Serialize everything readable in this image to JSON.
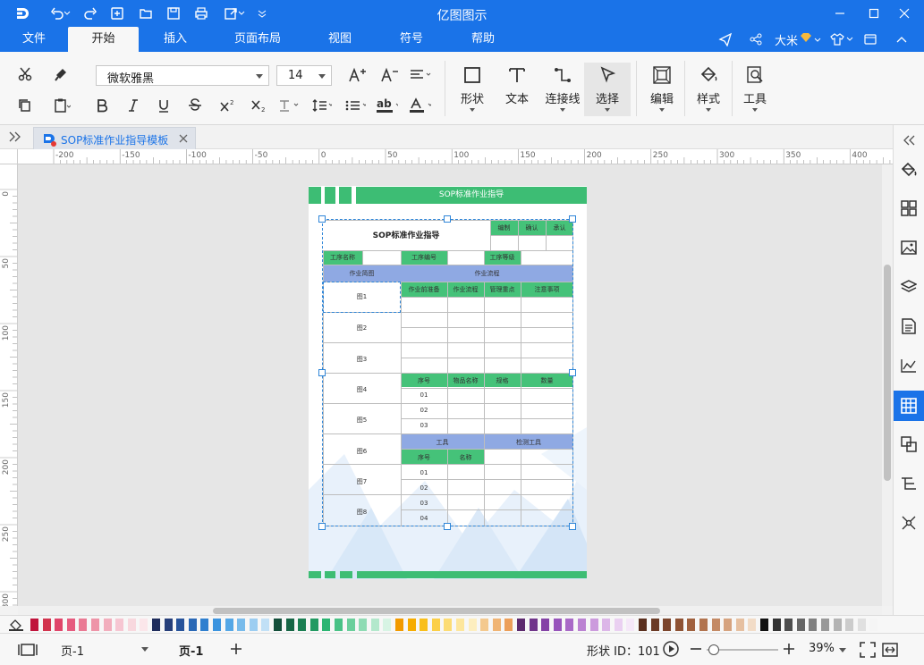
{
  "titlebar": {
    "title": "亿图图示"
  },
  "menu": {
    "tabs": [
      "文件",
      "开始",
      "插入",
      "页面布局",
      "视图",
      "符号",
      "帮助"
    ],
    "active": "开始",
    "user": "大米"
  },
  "ribbon": {
    "font_family": "微软雅黑",
    "font_size": "14",
    "big_buttons": [
      "形状",
      "文本",
      "连接线",
      "选择",
      "编辑",
      "样式",
      "工具"
    ]
  },
  "doc_tab": {
    "title": "SOP标准作业指导模板"
  },
  "ruler_h": [
    "-200",
    "-150",
    "-100",
    "-50",
    "0",
    "50",
    "100",
    "150",
    "200",
    "250",
    "300",
    "350",
    "400"
  ],
  "ruler_v": [
    "0",
    "50",
    "100",
    "150",
    "200",
    "250",
    "300"
  ],
  "sop": {
    "banner": "SOP标准作业指导",
    "title": "SOP标准作业指导",
    "approve": [
      "编制",
      "确认",
      "承认"
    ],
    "info": [
      "工序名称",
      "工序编号",
      "工序等级"
    ],
    "sections": [
      "作业简图",
      "作业流程"
    ],
    "flow_cols": [
      "作业前准备",
      "作业流程",
      "管理重点",
      "注意事项"
    ],
    "figures": [
      "图1",
      "图2",
      "图3",
      "图4",
      "图5",
      "图6",
      "图7",
      "图8"
    ],
    "material_cols": [
      "序号",
      "物品名称",
      "规格",
      "数量"
    ],
    "material_rows": [
      "01",
      "02",
      "03"
    ],
    "tool_headers": [
      "工具",
      "检测工具"
    ],
    "tool_cols": [
      "序号",
      "名称"
    ],
    "tool_rows": [
      "01",
      "02",
      "03",
      "04"
    ]
  },
  "status": {
    "page_selector": "页-1",
    "page_tab": "页-1",
    "shape_id": "形状 ID：101",
    "zoom": "39%"
  },
  "palette": [
    "#c0143c",
    "#d2344e",
    "#e0456a",
    "#e65b7f",
    "#ea7a94",
    "#ee94a8",
    "#f2aebd",
    "#f6c6d2",
    "#f8d8de",
    "#fbe6ea",
    "#1f2d5c",
    "#263f7a",
    "#27539a",
    "#2a68b6",
    "#2f7fcf",
    "#3b94df",
    "#55a7e6",
    "#78bbeb",
    "#9ccdf1",
    "#c1e0f6",
    "#134e3a",
    "#176646",
    "#1b7f53",
    "#229a62",
    "#2bb572",
    "#49c286",
    "#6bcf9c",
    "#8fdbb4",
    "#b3e8cc",
    "#d7f4e4",
    "#f29a00",
    "#f6ac00",
    "#f9bf1a",
    "#fbcf47",
    "#fcdc74",
    "#fde69c",
    "#fdeebf",
    "#f4c98e",
    "#f0b474",
    "#ec9f5a",
    "#5d2a6e",
    "#70358a",
    "#8442a6",
    "#9754bb",
    "#a96ac7",
    "#bb82d2",
    "#cc9bdd",
    "#dcb6e8",
    "#ead0f1",
    "#f5e8f8",
    "#5a2f1e",
    "#6b3a25",
    "#7c452c",
    "#8e5234",
    "#a0613f",
    "#b2744f",
    "#c48a65",
    "#d6a37f",
    "#e6c0a1",
    "#f2dcc7",
    "#111111",
    "#333333",
    "#4d4d4d",
    "#666666",
    "#808080",
    "#999999",
    "#b3b3b3",
    "#cccccc",
    "#e0e0e0",
    "#f5f5f5"
  ],
  "accent": "#1a73e8"
}
